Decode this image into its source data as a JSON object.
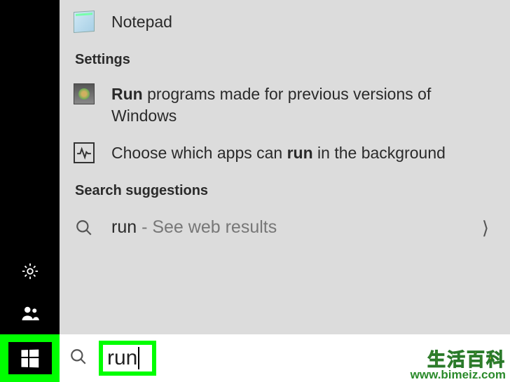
{
  "taskbar": {
    "settings_icon": "gear-icon",
    "people_icon": "people-icon",
    "start_icon": "windows-logo"
  },
  "search": {
    "query": "run"
  },
  "results": {
    "apps": [
      {
        "label": "Notepad",
        "icon": "notepad-icon"
      }
    ],
    "section_settings": "Settings",
    "settings": [
      {
        "prefix_bold": "Run",
        "rest": " programs made for previous versions of Windows",
        "icon": "compat-icon"
      },
      {
        "prefix": "Choose which apps can ",
        "bold": "run",
        "suffix": " in the background",
        "icon": "activity-icon"
      }
    ],
    "section_suggestions": "Search suggestions",
    "suggestions": [
      {
        "term": "run",
        "note": " - See web results"
      }
    ]
  },
  "watermark": {
    "cn": "生活百科",
    "url": "www.bimeiz.com"
  }
}
